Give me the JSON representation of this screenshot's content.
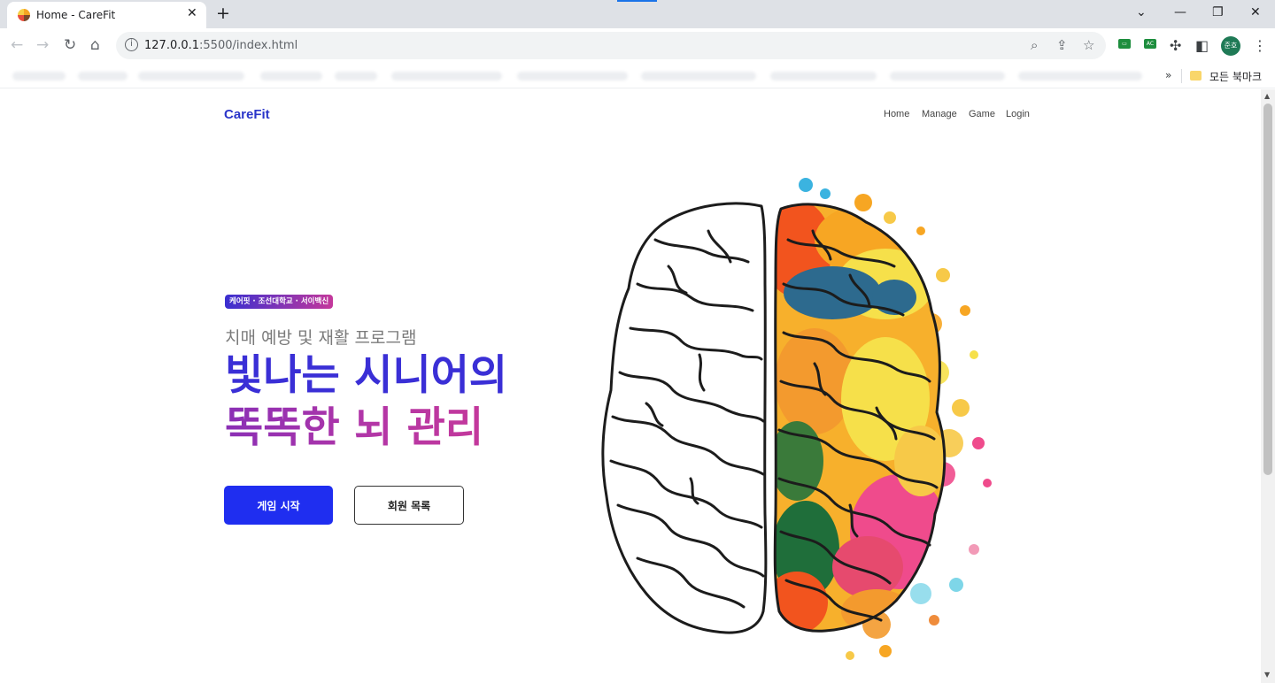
{
  "browser": {
    "tab_title": "Home - CareFit",
    "url_host": "127.0.0.1",
    "url_rest": ":5500/index.html",
    "bookmarks_folder": "모든 북마크",
    "profile_initials": "준호",
    "extension_badge": "AC"
  },
  "page": {
    "logo": "CareFit",
    "nav": [
      "Home",
      "Manage",
      "Game",
      "Login"
    ],
    "badge": "케어핏 · 조선대학교 · 서이백신",
    "subtitle": "치매 예방 및 재활 프로그램",
    "headline_line1": "빛나는 시니어의",
    "headline_line2": "똑똑한 뇌 관리",
    "buttons": {
      "start_game": "게임 시작",
      "member_list": "회원 목록"
    }
  },
  "colors": {
    "brand": "#2a35c9",
    "headline_blue": "#3a2fd6",
    "headline_purple": "#b236a7",
    "primary_button": "#1f2ef0"
  }
}
